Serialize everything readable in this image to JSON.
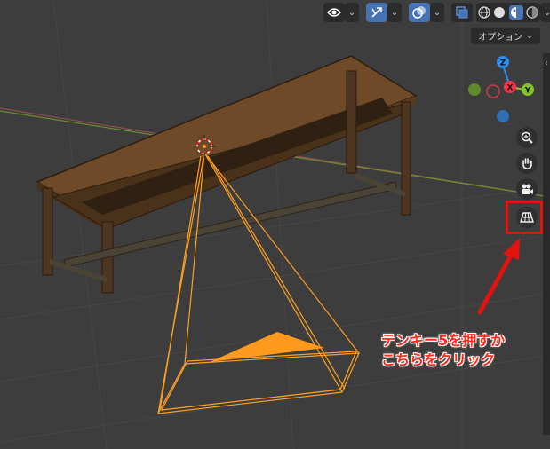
{
  "header": {
    "view_object_types_icon": "eye-icon",
    "gizmo_toggle_icon": "gizmo-arrow-icon",
    "overlays_toggle_icon": "overlay-circles-icon",
    "xray_icon": "xray-icon",
    "shading_modes": [
      "wireframe-icon",
      "solid-icon",
      "material-preview-icon",
      "rendered-icon"
    ],
    "active_shading_mode": "material-preview-icon",
    "options_label": "オプション"
  },
  "navigation_gizmo": {
    "axes": [
      {
        "axis": "Z",
        "color": "#2e8ff2"
      },
      {
        "axis": "X",
        "color": "#f5334f"
      },
      {
        "axis": "Y",
        "color": "#84c22a"
      }
    ]
  },
  "nav_buttons": [
    {
      "name": "zoom",
      "icon": "zoom-icon"
    },
    {
      "name": "pan",
      "icon": "hand-icon"
    },
    {
      "name": "camera-view",
      "icon": "camera-icon"
    },
    {
      "name": "perspective-toggle",
      "icon": "grid-perspective-icon"
    }
  ],
  "annotation": {
    "lines": [
      "テンキー5を押すか",
      "こちらをクリック"
    ],
    "color": "#e0140f"
  },
  "colors": {
    "viewport_bg": "#3d3d3d",
    "camera_frame": "#ff9a1f",
    "x_axis_line": "#8c3a3a",
    "y_axis_line": "#6f8f2e"
  }
}
